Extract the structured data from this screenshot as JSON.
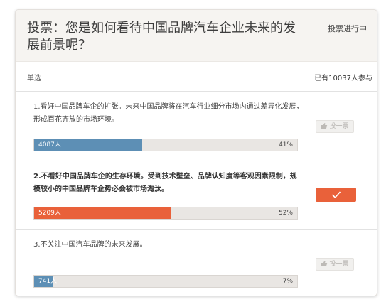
{
  "poll": {
    "title": "投票：您是如何看待中国品牌汽车企业未来的发展前景呢？",
    "status": "投票进行中",
    "type": "单选",
    "participants": "已有10037人参与"
  },
  "options": [
    {
      "text": "1.看好中国品牌车企的扩张。未来中国品牌将在汽车行业细分市场内通过差异化发展，形成百花齐放的市场环境。",
      "votes": "4087人",
      "percent_label": "41%",
      "percent": 41,
      "fill_color": "#5d8fb5",
      "button_label": "投一票",
      "selected": false
    },
    {
      "text": "2.不看好中国品牌车企的生存环境。受到技术壁垒、品牌认知度等客观因素限制，规模较小的中国品牌车企势必会被市场淘汰。",
      "votes": "5209人",
      "percent_label": "52%",
      "percent": 52,
      "fill_color": "#e9613a",
      "button_label": "",
      "selected": true
    },
    {
      "text": "3.不关注中国汽车品牌的未来发展。",
      "votes": "741人",
      "percent_label": "7%",
      "percent": 7,
      "fill_color": "#5d8fb5",
      "button_label": "投一票",
      "selected": false
    }
  ],
  "icons": {
    "vote": "thumbs-up-icon",
    "selected": "checkmark-icon"
  }
}
